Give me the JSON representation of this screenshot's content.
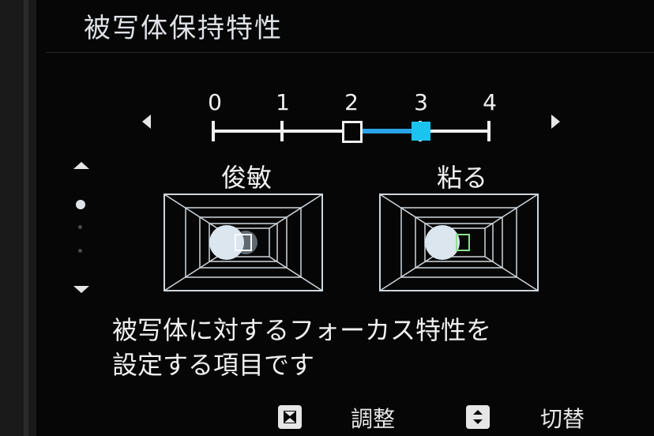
{
  "screen_title": "被写体保持特性",
  "scale": {
    "ticks": [
      "0",
      "1",
      "2",
      "3",
      "4"
    ],
    "selected_value": 3,
    "reference_value": 2
  },
  "modes": {
    "left_label": "俊敏",
    "right_label": "粘る"
  },
  "description": {
    "line1": "被写体に対するフォーカス特性を",
    "line2": "設定する項目です"
  },
  "footer": {
    "adjust_label": "調整",
    "switch_label": "切替"
  },
  "colors": {
    "accent_fill": "#1bc4ef",
    "accent_track": "#2aa4e8",
    "focus_frame_green": "#8fe08f"
  }
}
